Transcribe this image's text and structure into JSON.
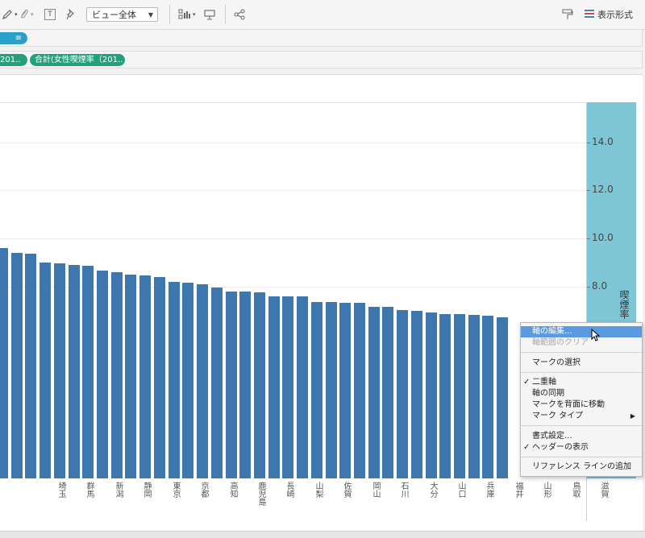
{
  "toolbar": {
    "view_select": "ビュー全体",
    "format_label": "表示形式",
    "icons": [
      "pen-icon",
      "paperclip-icon",
      "text-icon",
      "pin-icon",
      "show-me-icon",
      "presentation-icon",
      "share-icon",
      "format-brush-icon",
      "format-panel-icon"
    ]
  },
  "shelves": {
    "pill_row1_icon": "sort-icon",
    "pill_row2_a": "201..",
    "pill_row2_b": "合計(女性喫煙率（201..",
    "pill_color": "#23a17a",
    "pill_row1_color": "#2a9fc9"
  },
  "chart_data": {
    "type": "bar",
    "categories": [
      "",
      "",
      "",
      "",
      "埼玉",
      "",
      "群馬",
      "",
      "新潟",
      "",
      "静岡",
      "",
      "東京",
      "",
      "京都",
      "",
      "高知",
      "",
      "鹿児島",
      "",
      "長崎",
      "",
      "山梨",
      "",
      "佐賀",
      "",
      "岡山",
      "",
      "石川",
      "",
      "大分",
      "",
      "山口",
      "",
      "兵庫",
      "",
      "福井",
      "",
      "山形",
      "",
      "鳥取",
      "",
      "滋賀"
    ],
    "values": [
      9.6,
      9.4,
      9.35,
      9.0,
      8.95,
      8.9,
      8.85,
      8.65,
      8.6,
      8.5,
      8.45,
      8.4,
      8.2,
      8.15,
      8.1,
      7.95,
      7.8,
      7.78,
      7.75,
      7.6,
      7.58,
      7.58,
      7.35,
      7.34,
      7.32,
      7.3,
      7.15,
      7.15,
      7.0,
      6.98,
      6.9,
      6.85,
      6.83,
      6.8,
      6.78,
      6.7
    ],
    "ylabel": "喫煙率（2019年）",
    "yticks": [
      "14.0",
      "12.0",
      "10.0",
      "8.0"
    ],
    "ylim": [
      0,
      16
    ],
    "bar_color": "#3e77ad",
    "axis_color": "#7ec6d6",
    "grid": true
  },
  "menu": {
    "items": [
      {
        "label": "軸の編集...",
        "state": "highlight"
      },
      {
        "label": "軸範囲のクリア",
        "state": "disabled"
      },
      {
        "label": "マークの選択",
        "state": "normal"
      },
      {
        "label": "二重軸",
        "state": "checked"
      },
      {
        "label": "軸の同期",
        "state": "normal"
      },
      {
        "label": "マークを背面に移動",
        "state": "normal"
      },
      {
        "label": "マーク タイプ",
        "state": "submenu"
      },
      {
        "label": "書式設定...",
        "state": "normal"
      },
      {
        "label": "ヘッダーの表示",
        "state": "checked"
      },
      {
        "label": "リファレンス ラインの追加",
        "state": "normal"
      }
    ]
  }
}
